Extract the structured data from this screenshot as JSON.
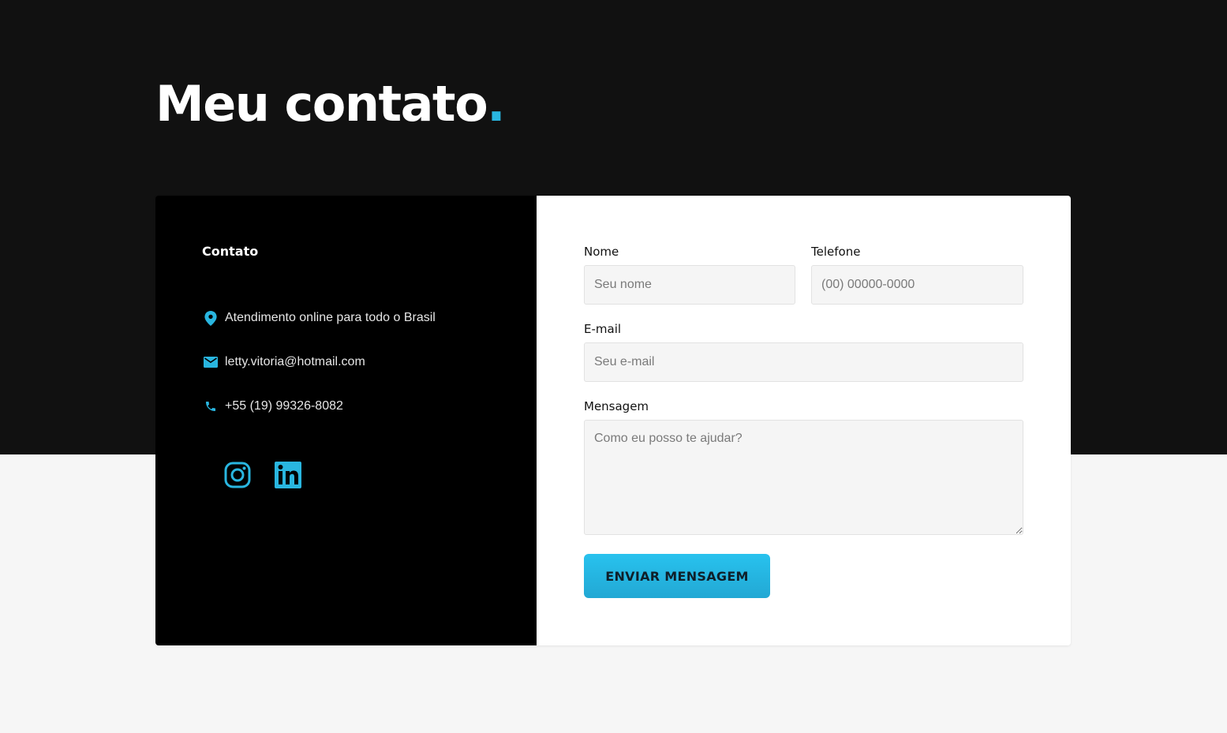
{
  "header": {
    "title": "Meu contato",
    "title_dot": "."
  },
  "contact": {
    "heading": "Contato",
    "items": [
      {
        "icon": "location-pin-icon",
        "text": "Atendimento online para todo o Brasil"
      },
      {
        "icon": "email-icon",
        "text": "letty.vitoria@hotmail.com"
      },
      {
        "icon": "phone-icon",
        "text": "+55 (19) 99326-8082"
      }
    ],
    "social": [
      {
        "icon": "instagram-icon"
      },
      {
        "icon": "linkedin-icon"
      }
    ]
  },
  "form": {
    "name_label": "Nome",
    "name_placeholder": "Seu nome",
    "phone_label": "Telefone",
    "phone_placeholder": "(00) 00000-0000",
    "email_label": "E-mail",
    "email_placeholder": "Seu e-mail",
    "message_label": "Mensagem",
    "message_placeholder": "Como eu posso te ajudar?",
    "submit_label": "ENVIAR MENSAGEM"
  },
  "colors": {
    "accent": "#29b6e0",
    "dark_band": "#111111",
    "card_left": "#000000",
    "page_bg": "#f6f6f6"
  }
}
